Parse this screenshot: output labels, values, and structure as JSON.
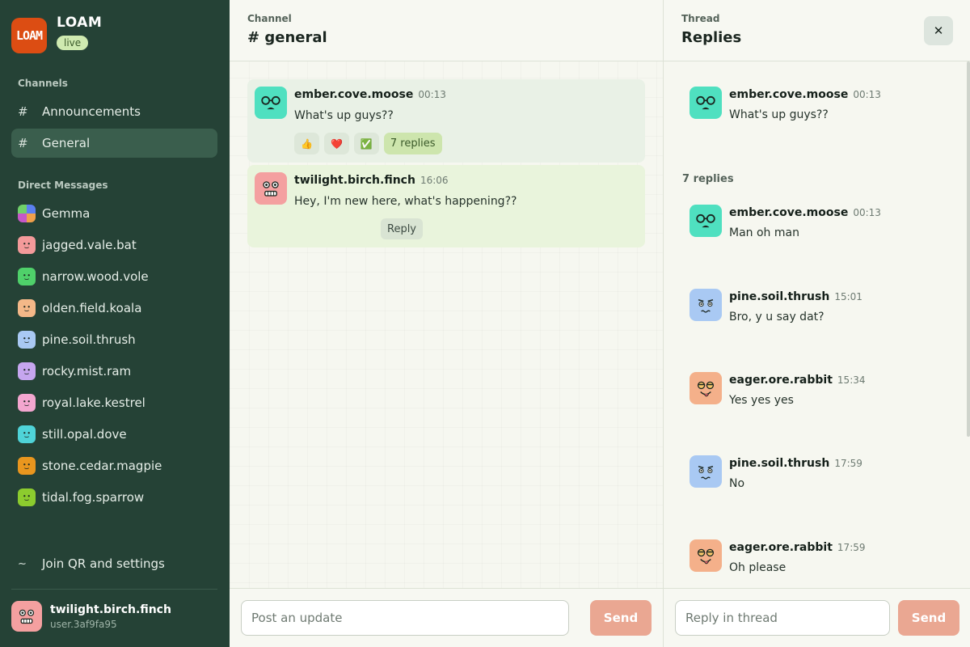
{
  "app": {
    "name": "LOAM",
    "logo_text": "LOAM",
    "status_badge": "live",
    "accent": "#dc4d13"
  },
  "sidebar": {
    "channels_label": "Channels",
    "channels": [
      {
        "label": "Announcements",
        "icon": "#",
        "active": false
      },
      {
        "label": "General",
        "icon": "#",
        "active": true
      }
    ],
    "dm_label": "Direct Messages",
    "dms": [
      {
        "label": "Gemma",
        "avatar_color": "#7b6fd6"
      },
      {
        "label": "jagged.vale.bat",
        "avatar_color": "#f39a9a"
      },
      {
        "label": "narrow.wood.vole",
        "avatar_color": "#4fd06a"
      },
      {
        "label": "olden.field.koala",
        "avatar_color": "#f4b888"
      },
      {
        "label": "pine.soil.thrush",
        "avatar_color": "#a9c9f3"
      },
      {
        "label": "rocky.mist.ram",
        "avatar_color": "#c6a6ef"
      },
      {
        "label": "royal.lake.kestrel",
        "avatar_color": "#f3a6cf"
      },
      {
        "label": "still.opal.dove",
        "avatar_color": "#4fd3d8"
      },
      {
        "label": "stone.cedar.magpie",
        "avatar_color": "#e9961e"
      },
      {
        "label": "tidal.fog.sparrow",
        "avatar_color": "#8ccc2e"
      }
    ],
    "settings_label": "Join QR and settings",
    "settings_icon": "~",
    "current_user": {
      "name": "twilight.birch.finch",
      "id": "user.3af9fa95",
      "avatar_color": "#f4a0a0"
    }
  },
  "channel": {
    "kicker": "Channel",
    "title": "# general",
    "messages": [
      {
        "author": "ember.cove.moose",
        "time": "00:13",
        "text": "What's up guys??",
        "avatar_color": "#4fe0c0",
        "reactions": [
          "👍",
          "❤️",
          "✅"
        ],
        "replies_label": "7 replies"
      },
      {
        "author": "twilight.birch.finch",
        "time": "16:06",
        "text": "Hey, I'm new here, what's happening??",
        "avatar_color": "#f4a0a0",
        "reply_label": "Reply"
      }
    ],
    "composer": {
      "placeholder": "Post an update",
      "send_label": "Send"
    }
  },
  "thread": {
    "kicker": "Thread",
    "title": "Replies",
    "close_icon": "✕",
    "parent": {
      "author": "ember.cove.moose",
      "time": "00:13",
      "text": "What's up guys??",
      "avatar_color": "#4fe0c0"
    },
    "replies_count": "7 replies",
    "replies": [
      {
        "author": "ember.cove.moose",
        "time": "00:13",
        "text": "Man oh man",
        "avatar_color": "#4fe0c0"
      },
      {
        "author": "pine.soil.thrush",
        "time": "15:01",
        "text": "Bro, y u say dat?",
        "avatar_color": "#a9c9f3"
      },
      {
        "author": "eager.ore.rabbit",
        "time": "15:34",
        "text": "Yes yes yes",
        "avatar_color": "#f4b08a"
      },
      {
        "author": "pine.soil.thrush",
        "time": "17:59",
        "text": "No",
        "avatar_color": "#a9c9f3"
      },
      {
        "author": "eager.ore.rabbit",
        "time": "17:59",
        "text": "Oh please",
        "avatar_color": "#f4b08a"
      }
    ],
    "composer": {
      "placeholder": "Reply in thread",
      "send_label": "Send"
    }
  }
}
